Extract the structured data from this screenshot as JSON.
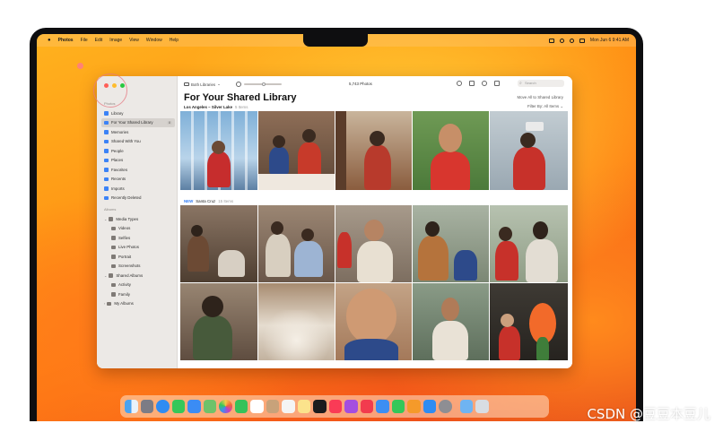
{
  "menubar": {
    "app_name": "Photos",
    "menus": [
      "File",
      "Edit",
      "Image",
      "View",
      "Window",
      "Help"
    ],
    "clock": "Mon Jun 6 9:41 AM"
  },
  "window": {
    "toolbar": {
      "libraries_label": "Both Libraries",
      "photo_count": "5,743 Photos",
      "search_placeholder": "Search"
    },
    "sidebar": {
      "section_photos": "Photos",
      "items": [
        {
          "label": "Library",
          "icon": "library-icon"
        },
        {
          "label": "For Your Shared Library",
          "icon": "shared-library-icon",
          "badge": "8"
        },
        {
          "label": "Memories",
          "icon": "memories-icon"
        },
        {
          "label": "Shared With You",
          "icon": "shared-with-you-icon"
        },
        {
          "label": "People",
          "icon": "people-icon"
        },
        {
          "label": "Places",
          "icon": "places-icon"
        },
        {
          "label": "Favorites",
          "icon": "heart-icon"
        },
        {
          "label": "Recents",
          "icon": "clock-icon"
        },
        {
          "label": "Imports",
          "icon": "imports-icon"
        },
        {
          "label": "Recently Deleted",
          "icon": "trash-icon"
        }
      ],
      "section_albums": "Albums",
      "media_types_label": "Media Types",
      "media_types": [
        {
          "label": "Videos",
          "icon": "video-icon"
        },
        {
          "label": "Selfies",
          "icon": "selfie-icon"
        },
        {
          "label": "Live Photos",
          "icon": "live-photo-icon"
        },
        {
          "label": "Portrait",
          "icon": "portrait-icon"
        },
        {
          "label": "Screenshots",
          "icon": "screenshot-icon"
        }
      ],
      "shared_albums_label": "Shared Albums",
      "shared_albums": [
        {
          "label": "Activity",
          "icon": "activity-icon"
        },
        {
          "label": "Family",
          "icon": "family-icon"
        }
      ],
      "my_albums_label": "My Albums"
    },
    "main": {
      "title": "For Your Shared Library",
      "show_all": "Move All to Shared Library",
      "filter": "Filter By: All Items",
      "group1": {
        "place": "Los Angeles – Silver Lake",
        "count": "5 Items"
      },
      "group2": {
        "new_badge": "NEW",
        "place": "Santa Cruz",
        "count": "15 Items"
      }
    }
  },
  "colors": {
    "wallpaper_accent": "#ff9a16",
    "selection": "#d6d2ce",
    "new_badge": "#2f7bf5"
  },
  "dock_apps": [
    "finder-icon",
    "launchpad-icon",
    "safari-icon",
    "messages-icon",
    "mail-icon",
    "maps-icon",
    "photos-icon",
    "facetime-icon",
    "calendar-icon",
    "contacts-icon",
    "reminders-icon",
    "notes-icon",
    "tv-icon",
    "music-icon",
    "podcasts-icon",
    "news-icon",
    "keynote-icon",
    "numbers-icon",
    "pages-icon",
    "app-store-icon",
    "system-settings-icon",
    "folder-icon",
    "trash-icon"
  ],
  "watermark": "CSDN @豆豆本豆儿"
}
